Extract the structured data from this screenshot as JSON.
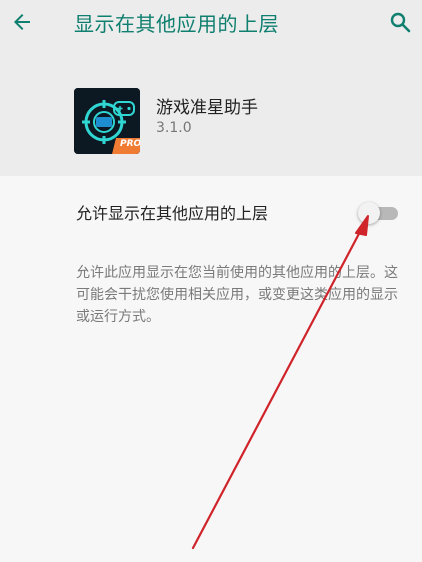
{
  "appbar": {
    "title": "显示在其他应用的上层",
    "back_icon": "arrow-left-icon",
    "search_icon": "search-icon"
  },
  "app": {
    "name": "游戏准星助手",
    "version": "3.1.0",
    "badge": "PRO"
  },
  "permission": {
    "label": "允许显示在其他应用的上层",
    "enabled": false,
    "description": "允许此应用显示在您当前使用的其他应用的上层。这可能会干扰您使用相关应用，或变更这类应用的显示或运行方式。"
  },
  "colors": {
    "accent": "#0f7f6f",
    "annotation_arrow": "#d0242b"
  }
}
